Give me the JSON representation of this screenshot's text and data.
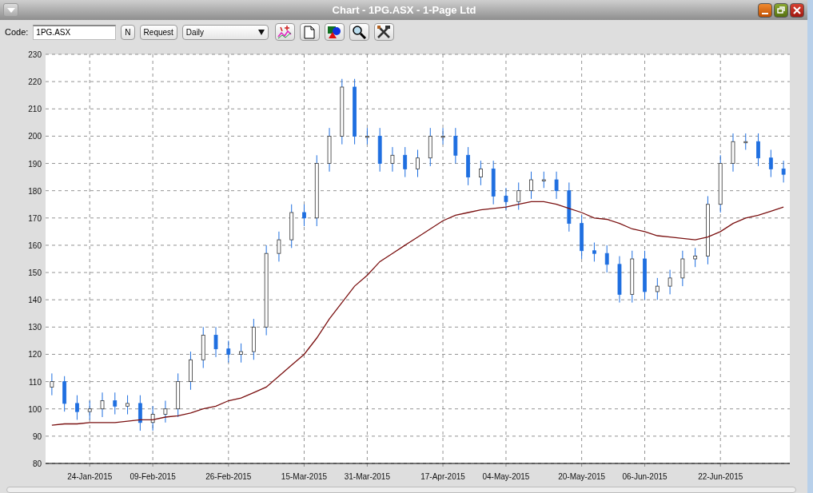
{
  "window": {
    "title": "Chart - 1PG.ASX - 1-Page Ltd"
  },
  "toolbar": {
    "code_label": "Code:",
    "code_value": "1PG.ASX",
    "buttons": [
      "N",
      "Request"
    ],
    "period": "Daily"
  },
  "chart_data": {
    "type": "candlestick",
    "categories": [
      null,
      null,
      null,
      "24-Jan-2015",
      null,
      null,
      null,
      null,
      "09-Feb-2015",
      null,
      null,
      null,
      null,
      null,
      "26-Feb-2015",
      null,
      null,
      null,
      null,
      null,
      "15-Mar-2015",
      null,
      null,
      null,
      null,
      "31-Mar-2015",
      null,
      null,
      null,
      null,
      null,
      "17-Apr-2015",
      null,
      null,
      null,
      null,
      "04-May-2015",
      null,
      null,
      null,
      null,
      null,
      "20-May-2015",
      null,
      null,
      null,
      null,
      "06-Jun-2015",
      null,
      null,
      null,
      null,
      null,
      "22-Jun-2015",
      null,
      null,
      null,
      null,
      null
    ],
    "ohlc": [
      [
        108,
        113,
        105,
        110
      ],
      [
        110,
        112,
        99,
        102
      ],
      [
        102,
        105,
        96,
        99
      ],
      [
        99,
        103,
        96,
        100
      ],
      [
        100,
        106,
        97,
        103
      ],
      [
        103,
        106,
        98,
        101
      ],
      [
        101,
        105,
        98,
        102
      ],
      [
        102,
        105,
        92,
        95
      ],
      [
        95,
        101,
        92,
        98
      ],
      [
        98,
        103,
        95,
        100
      ],
      [
        100,
        113,
        97,
        110
      ],
      [
        110,
        121,
        107,
        118
      ],
      [
        118,
        130,
        115,
        127
      ],
      [
        127,
        130,
        119,
        122
      ],
      [
        122,
        125,
        117,
        120
      ],
      [
        120,
        124,
        117,
        121
      ],
      [
        121,
        133,
        118,
        130
      ],
      [
        130,
        160,
        127,
        157
      ],
      [
        157,
        165,
        154,
        162
      ],
      [
        162,
        175,
        159,
        172
      ],
      [
        172,
        175,
        167,
        170
      ],
      [
        170,
        193,
        167,
        190
      ],
      [
        190,
        203,
        187,
        200
      ],
      [
        200,
        221,
        197,
        218
      ],
      [
        218,
        221,
        197,
        200
      ],
      [
        200,
        203,
        197,
        200
      ],
      [
        200,
        203,
        187,
        190
      ],
      [
        190,
        196,
        187,
        193
      ],
      [
        193,
        196,
        185,
        188
      ],
      [
        188,
        195,
        185,
        192
      ],
      [
        192,
        203,
        189,
        200
      ],
      [
        200,
        203,
        197,
        200
      ],
      [
        200,
        203,
        190,
        193
      ],
      [
        193,
        196,
        182,
        185
      ],
      [
        185,
        191,
        182,
        188
      ],
      [
        188,
        191,
        175,
        178
      ],
      [
        178,
        181,
        173,
        176
      ],
      [
        176,
        183,
        173,
        180
      ],
      [
        180,
        187,
        177,
        184
      ],
      [
        184,
        187,
        181,
        184
      ],
      [
        184,
        187,
        177,
        180
      ],
      [
        180,
        183,
        165,
        168
      ],
      [
        168,
        171,
        155,
        158
      ],
      [
        158,
        161,
        154,
        157
      ],
      [
        157,
        160,
        150,
        153
      ],
      [
        153,
        156,
        139,
        142
      ],
      [
        142,
        158,
        139,
        155
      ],
      [
        155,
        158,
        140,
        143
      ],
      [
        143,
        148,
        140,
        145
      ],
      [
        145,
        151,
        142,
        148
      ],
      [
        148,
        158,
        145,
        155
      ],
      [
        155,
        159,
        152,
        156
      ],
      [
        156,
        178,
        153,
        175
      ],
      [
        175,
        193,
        172,
        190
      ],
      [
        190,
        201,
        187,
        198
      ],
      [
        198,
        201,
        195,
        198
      ],
      [
        198,
        201,
        189,
        192
      ],
      [
        192,
        195,
        185,
        188
      ],
      [
        188,
        191,
        183,
        186
      ]
    ],
    "series": [
      {
        "type": "line",
        "color": "#7a1010",
        "values": [
          94,
          94.5,
          94.5,
          95,
          95,
          95,
          95.5,
          96,
          96,
          97,
          97.5,
          98.5,
          100,
          101,
          103,
          104,
          106,
          108,
          112,
          116,
          120,
          126,
          133,
          139,
          145,
          149,
          154,
          157,
          160,
          163,
          166,
          169,
          171,
          172,
          173,
          173.5,
          174,
          175,
          176,
          176,
          175,
          173.5,
          172,
          170,
          169.5,
          168,
          166,
          165,
          163.5,
          163,
          162.5,
          162,
          163,
          165,
          168,
          170,
          171,
          172.5,
          174
        ]
      }
    ],
    "ylim": [
      80,
      230
    ],
    "grid": true,
    "yticks": [
      80,
      90,
      100,
      110,
      120,
      130,
      140,
      150,
      160,
      170,
      180,
      190,
      200,
      210,
      220,
      230
    ]
  }
}
